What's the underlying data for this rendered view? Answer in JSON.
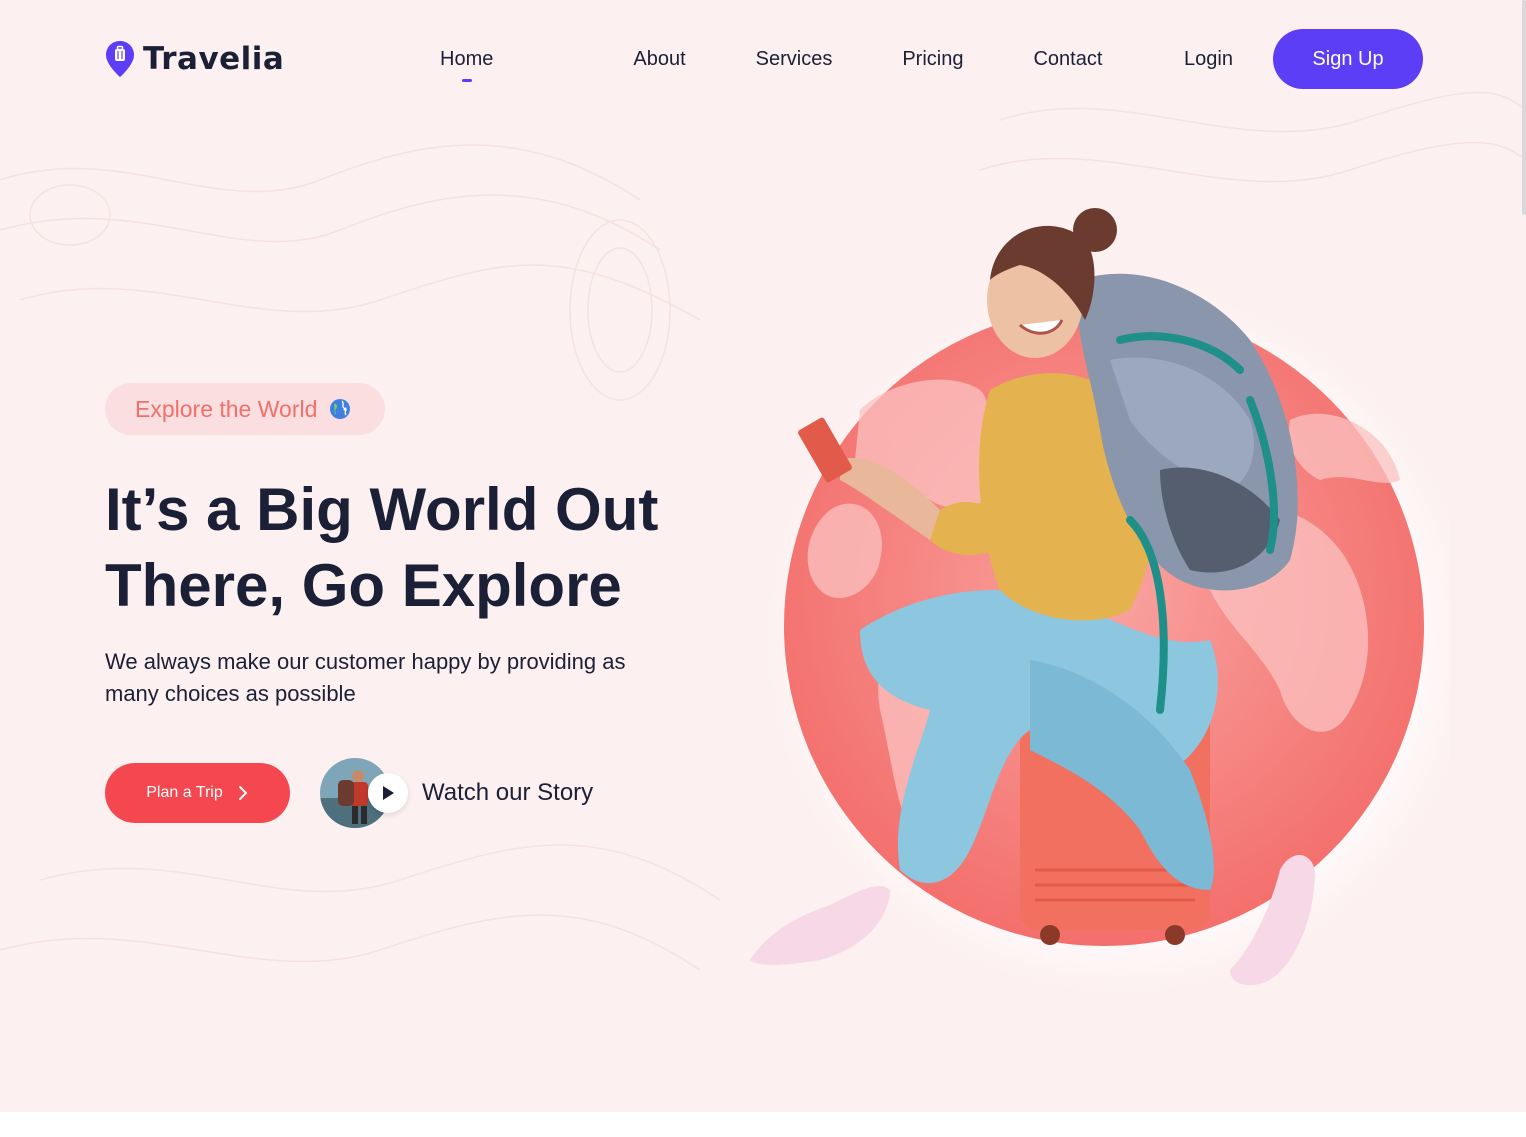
{
  "brand": {
    "name": "Travelia",
    "accent": "#5b3ef5"
  },
  "nav": {
    "items": [
      {
        "label": "Home",
        "active": true
      },
      {
        "label": "About",
        "active": false
      },
      {
        "label": "Services",
        "active": false
      },
      {
        "label": "Pricing",
        "active": false
      },
      {
        "label": "Contact",
        "active": false
      }
    ],
    "login": "Login",
    "signup": "Sign Up"
  },
  "hero": {
    "badge": "Explore the World",
    "badge_icon": "globe-icon",
    "headline": [
      "It’s a Big World Out",
      "There, Go Explore"
    ],
    "subtext": "We always make our customer happy by providing as many choices as possible",
    "cta": "Plan a Trip",
    "cta_icon": "chevron-right-icon",
    "story": "Watch our Story",
    "story_icon": "play-icon",
    "colors": {
      "cta": "#f5474f",
      "globe": "#f47a78",
      "badge_text": "#f26f6a"
    }
  }
}
